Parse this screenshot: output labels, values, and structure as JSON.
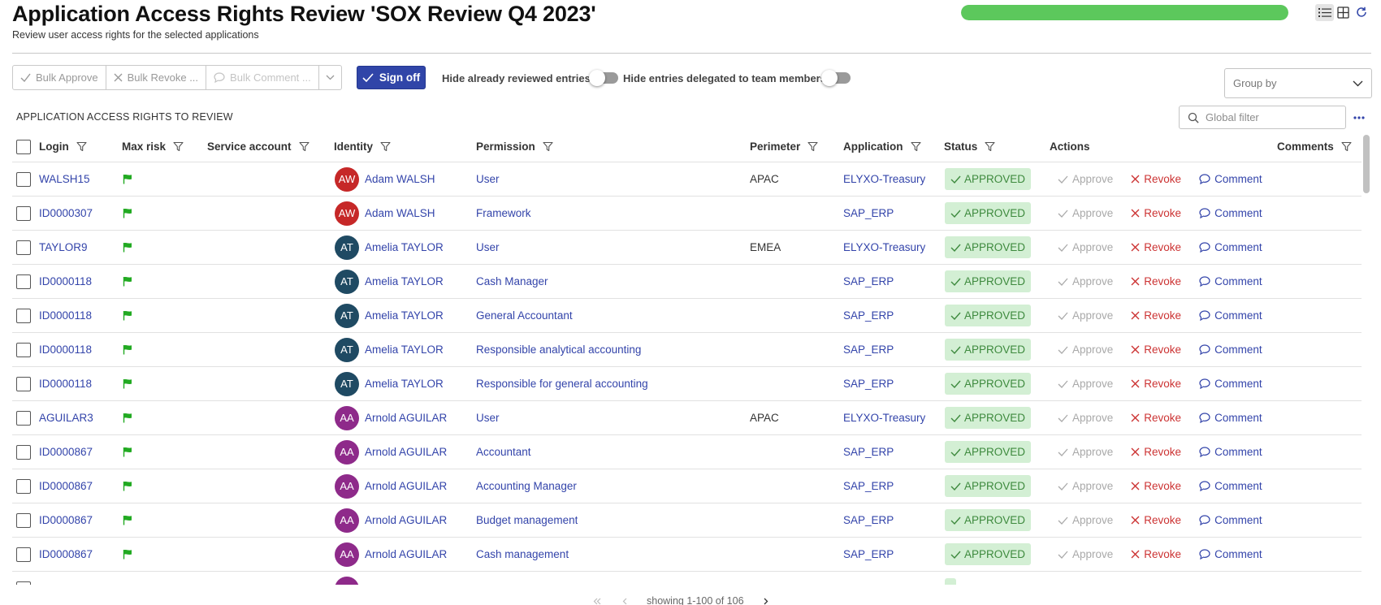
{
  "header": {
    "title": "Application Access Rights Review 'SOX Review Q4 2023'",
    "subtitle": "Review user access rights for the selected applications",
    "progress_fraction": 1.0
  },
  "colors": {
    "accent": "#3045a8",
    "link": "#3344aa",
    "progress": "#5cc85c",
    "approved_bg": "#d3efd4",
    "approved_text": "#3e8a3e",
    "revoke": "#cc3333",
    "risk_flag": "#22aa22"
  },
  "icons": {
    "list_view": "list-view-icon",
    "grid_view": "grid-view-icon",
    "refresh": "refresh-icon",
    "filter": "filter-icon",
    "flag": "flag-icon",
    "check": "check-icon",
    "close": "close-icon",
    "comment": "comment-icon",
    "search": "search-icon",
    "more": "more-icon",
    "chevron_down": "chevron-down-icon"
  },
  "toolbar": {
    "bulk_approve": "Bulk Approve",
    "bulk_revoke": "Bulk Revoke ...",
    "bulk_comment": "Bulk Comment ...",
    "sign_off": "Sign off",
    "hide_reviewed": "Hide already reviewed entries",
    "hide_delegated": "Hide entries delegated to team members",
    "group_by": "Group by"
  },
  "section_title": "APPLICATION ACCESS RIGHTS TO REVIEW",
  "global_filter_placeholder": "Global filter",
  "columns": {
    "login": "Login",
    "max_risk": "Max risk",
    "service_account": "Service account",
    "identity": "Identity",
    "permission": "Permission",
    "perimeter": "Perimeter",
    "application": "Application",
    "status": "Status",
    "actions": "Actions",
    "comments": "Comments"
  },
  "actions": {
    "approve": "Approve",
    "revoke": "Revoke",
    "comment": "Comment"
  },
  "rows": [
    {
      "login": "WALSH15",
      "initials": "AW",
      "avatar_color": "#c62828",
      "identity": "Adam WALSH",
      "permission": "User",
      "perimeter": "APAC",
      "application": "ELYXO-Treasury",
      "status": "APPROVED"
    },
    {
      "login": "ID0000307",
      "initials": "AW",
      "avatar_color": "#c62828",
      "identity": "Adam WALSH",
      "permission": "Framework",
      "perimeter": "",
      "application": "SAP_ERP",
      "status": "APPROVED"
    },
    {
      "login": "TAYLOR9",
      "initials": "AT",
      "avatar_color": "#1f4a63",
      "identity": "Amelia TAYLOR",
      "permission": "User",
      "perimeter": "EMEA",
      "application": "ELYXO-Treasury",
      "status": "APPROVED"
    },
    {
      "login": "ID0000118",
      "initials": "AT",
      "avatar_color": "#1f4a63",
      "identity": "Amelia TAYLOR",
      "permission": "Cash Manager",
      "perimeter": "",
      "application": "SAP_ERP",
      "status": "APPROVED"
    },
    {
      "login": "ID0000118",
      "initials": "AT",
      "avatar_color": "#1f4a63",
      "identity": "Amelia TAYLOR",
      "permission": "General Accountant",
      "perimeter": "",
      "application": "SAP_ERP",
      "status": "APPROVED"
    },
    {
      "login": "ID0000118",
      "initials": "AT",
      "avatar_color": "#1f4a63",
      "identity": "Amelia TAYLOR",
      "permission": "Responsible analytical accounting",
      "perimeter": "",
      "application": "SAP_ERP",
      "status": "APPROVED"
    },
    {
      "login": "ID0000118",
      "initials": "AT",
      "avatar_color": "#1f4a63",
      "identity": "Amelia TAYLOR",
      "permission": "Responsible for general accounting",
      "perimeter": "",
      "application": "SAP_ERP",
      "status": "APPROVED"
    },
    {
      "login": "AGUILAR3",
      "initials": "AA",
      "avatar_color": "#8e2a8a",
      "identity": "Arnold AGUILAR",
      "permission": "User",
      "perimeter": "APAC",
      "application": "ELYXO-Treasury",
      "status": "APPROVED"
    },
    {
      "login": "ID0000867",
      "initials": "AA",
      "avatar_color": "#8e2a8a",
      "identity": "Arnold AGUILAR",
      "permission": "Accountant",
      "perimeter": "",
      "application": "SAP_ERP",
      "status": "APPROVED"
    },
    {
      "login": "ID0000867",
      "initials": "AA",
      "avatar_color": "#8e2a8a",
      "identity": "Arnold AGUILAR",
      "permission": "Accounting Manager",
      "perimeter": "",
      "application": "SAP_ERP",
      "status": "APPROVED"
    },
    {
      "login": "ID0000867",
      "initials": "AA",
      "avatar_color": "#8e2a8a",
      "identity": "Arnold AGUILAR",
      "permission": "Budget management",
      "perimeter": "",
      "application": "SAP_ERP",
      "status": "APPROVED"
    },
    {
      "login": "ID0000867",
      "initials": "AA",
      "avatar_color": "#8e2a8a",
      "identity": "Arnold AGUILAR",
      "permission": "Cash management",
      "perimeter": "",
      "application": "SAP_ERP",
      "status": "APPROVED"
    }
  ],
  "pagination": {
    "text": "showing 1-100 of 106"
  }
}
